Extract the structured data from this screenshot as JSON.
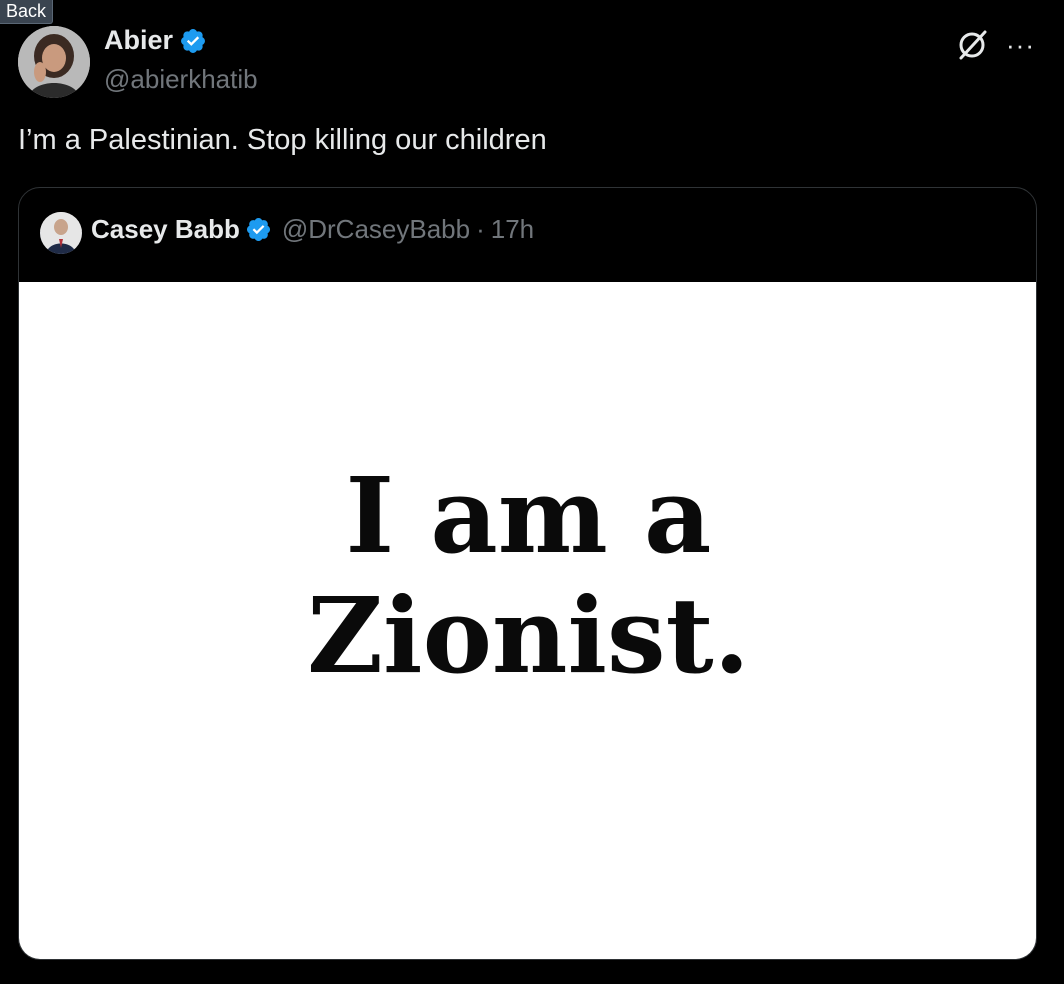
{
  "back_label": "Back",
  "tweet": {
    "author_name": "Abier",
    "author_handle": "@abierkhatib",
    "text": "I’m a Palestinian. Stop killing our children",
    "more_label": "···"
  },
  "quoted_tweet": {
    "author_name": "Casey Babb",
    "author_handle": "@DrCaseyBabb",
    "separator": "·",
    "time": "17h",
    "image_text_line_1": "I am a",
    "image_text_line_2": "Zionist."
  },
  "colors": {
    "background": "#000000",
    "text_primary": "#e7e9ea",
    "text_secondary": "#71767b",
    "verified_blue": "#1d9bf0",
    "card_border": "#2f3336"
  },
  "icons": {
    "verified": "verified-badge-icon",
    "grok": "grok-icon",
    "more": "more-options-icon"
  }
}
